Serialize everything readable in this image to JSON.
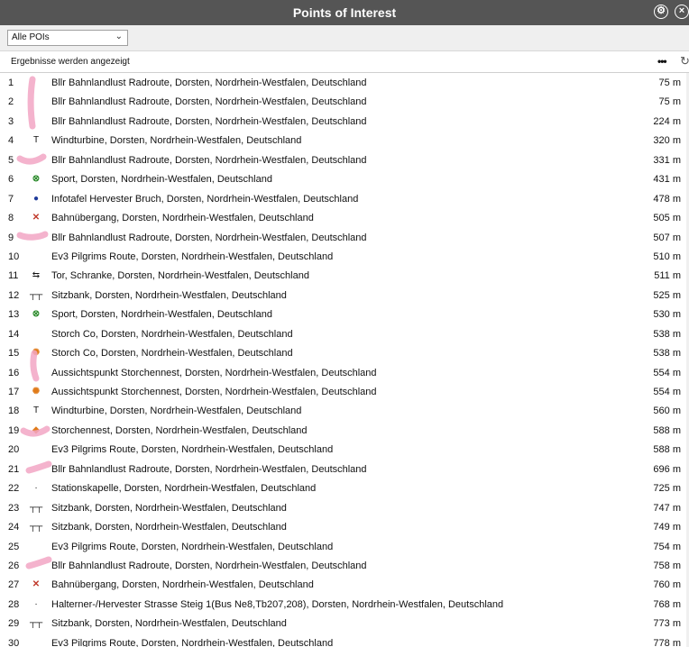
{
  "window": {
    "title": "Points of Interest",
    "settings_icon": "gear-icon",
    "close_icon": "close-icon"
  },
  "filter": {
    "selected": "Alle POIs"
  },
  "status": {
    "text": "Ergebnisse werden angezeigt"
  },
  "rows": [
    {
      "n": "1",
      "icon": "",
      "name": "Bllr Bahnlandlust Radroute, Dorsten, Nordrhein-Westfalen, Deutschland",
      "dist": "75 m"
    },
    {
      "n": "2",
      "icon": "",
      "name": "Bllr Bahnlandlust Radroute, Dorsten, Nordrhein-Westfalen, Deutschland",
      "dist": "75 m"
    },
    {
      "n": "3",
      "icon": "",
      "name": "Bllr Bahnlandlust Radroute, Dorsten, Nordrhein-Westfalen, Deutschland",
      "dist": "224 m"
    },
    {
      "n": "4",
      "icon": "wind-turbine-icon",
      "name": "Windturbine, Dorsten, Nordrhein-Westfalen, Deutschland",
      "dist": "320 m"
    },
    {
      "n": "5",
      "icon": "",
      "name": "Bllr Bahnlandlust Radroute, Dorsten, Nordrhein-Westfalen, Deutschland",
      "dist": "331 m"
    },
    {
      "n": "6",
      "icon": "sport-icon",
      "name": "Sport, Dorsten, Nordrhein-Westfalen, Deutschland",
      "dist": "431 m"
    },
    {
      "n": "7",
      "icon": "info-icon",
      "name": "Infotafel Hervester Bruch, Dorsten, Nordrhein-Westfalen, Deutschland",
      "dist": "478 m"
    },
    {
      "n": "8",
      "icon": "railway-crossing-icon",
      "name": "Bahnübergang, Dorsten, Nordrhein-Westfalen, Deutschland",
      "dist": "505 m"
    },
    {
      "n": "9",
      "icon": "",
      "name": "Bllr Bahnlandlust Radroute, Dorsten, Nordrhein-Westfalen, Deutschland",
      "dist": "507 m"
    },
    {
      "n": "10",
      "icon": "",
      "name": "Ev3 Pilgrims Route, Dorsten, Nordrhein-Westfalen, Deutschland",
      "dist": "510 m"
    },
    {
      "n": "11",
      "icon": "gate-icon",
      "name": "Tor, Schranke, Dorsten, Nordrhein-Westfalen, Deutschland",
      "dist": "511 m"
    },
    {
      "n": "12",
      "icon": "bench-icon",
      "name": "Sitzbank, Dorsten, Nordrhein-Westfalen, Deutschland",
      "dist": "525 m"
    },
    {
      "n": "13",
      "icon": "sport-icon",
      "name": "Sport, Dorsten, Nordrhein-Westfalen, Deutschland",
      "dist": "530 m"
    },
    {
      "n": "14",
      "icon": "",
      "name": "Storch Co, Dorsten, Nordrhein-Westfalen, Deutschland",
      "dist": "538 m"
    },
    {
      "n": "15",
      "icon": "viewpoint-icon",
      "name": "Storch Co, Dorsten, Nordrhein-Westfalen, Deutschland",
      "dist": "538 m"
    },
    {
      "n": "16",
      "icon": "",
      "name": "Aussichtspunkt Storchennest, Dorsten, Nordrhein-Westfalen, Deutschland",
      "dist": "554 m"
    },
    {
      "n": "17",
      "icon": "viewpoint-icon",
      "name": "Aussichtspunkt Storchennest, Dorsten, Nordrhein-Westfalen, Deutschland",
      "dist": "554 m"
    },
    {
      "n": "18",
      "icon": "wind-turbine-icon",
      "name": "Windturbine, Dorsten, Nordrhein-Westfalen, Deutschland",
      "dist": "560 m"
    },
    {
      "n": "19",
      "icon": "point-icon",
      "name": "Storchennest, Dorsten, Nordrhein-Westfalen, Deutschland",
      "dist": "588 m"
    },
    {
      "n": "20",
      "icon": "",
      "name": "Ev3 Pilgrims Route, Dorsten, Nordrhein-Westfalen, Deutschland",
      "dist": "588 m"
    },
    {
      "n": "21",
      "icon": "",
      "name": "Bllr Bahnlandlust Radroute, Dorsten, Nordrhein-Westfalen, Deutschland",
      "dist": "696 m"
    },
    {
      "n": "22",
      "icon": "dot-icon",
      "name": "Stationskapelle, Dorsten, Nordrhein-Westfalen, Deutschland",
      "dist": "725 m"
    },
    {
      "n": "23",
      "icon": "bench-icon",
      "name": "Sitzbank, Dorsten, Nordrhein-Westfalen, Deutschland",
      "dist": "747 m"
    },
    {
      "n": "24",
      "icon": "bench-icon",
      "name": "Sitzbank, Dorsten, Nordrhein-Westfalen, Deutschland",
      "dist": "749 m"
    },
    {
      "n": "25",
      "icon": "",
      "name": "Ev3 Pilgrims Route, Dorsten, Nordrhein-Westfalen, Deutschland",
      "dist": "754 m"
    },
    {
      "n": "26",
      "icon": "",
      "name": "Bllr Bahnlandlust Radroute, Dorsten, Nordrhein-Westfalen, Deutschland",
      "dist": "758 m"
    },
    {
      "n": "27",
      "icon": "railway-crossing-icon",
      "name": "Bahnübergang, Dorsten, Nordrhein-Westfalen, Deutschland",
      "dist": "760 m"
    },
    {
      "n": "28",
      "icon": "dot-icon",
      "name": "Halterner-/Hervester Strasse Steig 1(Bus Ne8,Tb207,208), Dorsten, Nordrhein-Westfalen, Deutschland",
      "dist": "768 m"
    },
    {
      "n": "29",
      "icon": "bench-icon",
      "name": "Sitzbank, Dorsten, Nordrhein-Westfalen, Deutschland",
      "dist": "773 m"
    },
    {
      "n": "30",
      "icon": "",
      "name": "Ev3 Pilgrims Route, Dorsten, Nordrhein-Westfalen, Deutschland",
      "dist": "778 m"
    }
  ]
}
